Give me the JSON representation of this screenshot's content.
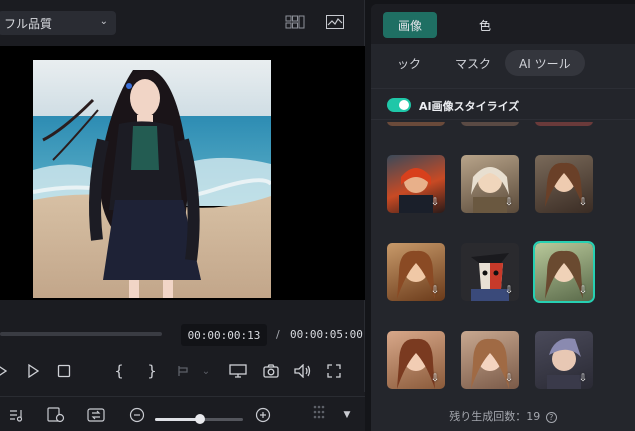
{
  "player": {
    "quality": "フル品質",
    "timecode_current": "00:00:00:13",
    "timecode_separator": "/",
    "timecode_total": "00:00:05:00"
  },
  "right_panel": {
    "tabs": [
      "画像",
      "色"
    ],
    "subtabs": [
      "ック",
      "マスク",
      "AI ツール"
    ],
    "toggle_label": "AI画像スタイライズ",
    "remaining": "残り生成回数：19"
  },
  "colors": {
    "accent": "#1fc7a8",
    "tab_active": "#1f6f63"
  }
}
